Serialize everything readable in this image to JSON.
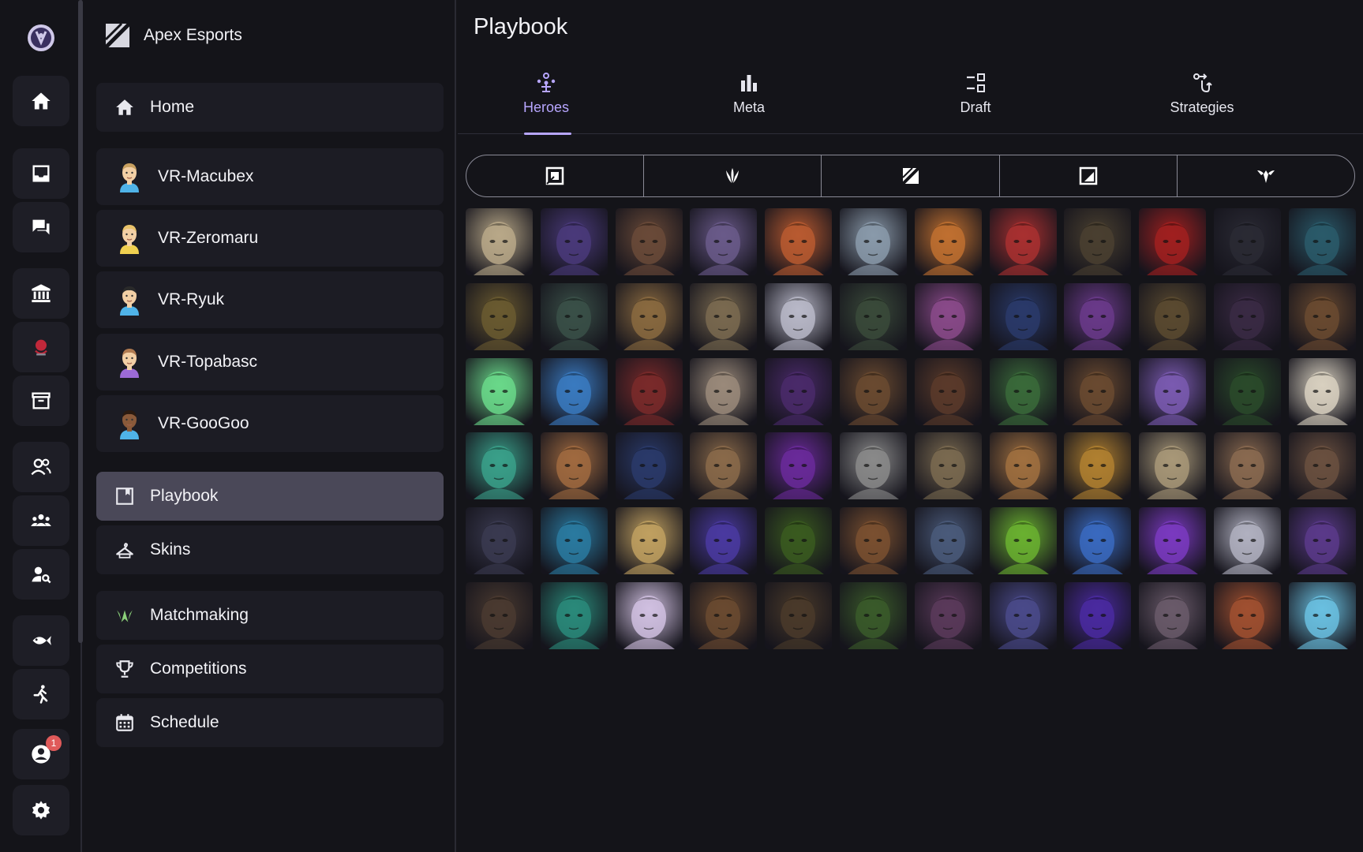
{
  "org": {
    "name": "Apex Esports"
  },
  "rail": {
    "items": [
      "logo-icon",
      "home-icon",
      "inbox-icon",
      "chat-icon",
      "bank-icon",
      "team-logo-icon",
      "archive-icon",
      "people-icon",
      "groups-icon",
      "person-search-icon",
      "fish-icon",
      "running-icon",
      "account-icon",
      "settings-icon"
    ],
    "notification_count": "1"
  },
  "nav": {
    "home": "Home",
    "players": [
      {
        "name": "VR-Macubex",
        "skin": "#f2cfa5",
        "hair": "#c8a060",
        "shirt": "#4fb3e8"
      },
      {
        "name": "VR-Zeromaru",
        "skin": "#f2cfa5",
        "hair": "#e8c26a",
        "shirt": "#f0d050"
      },
      {
        "name": "VR-Ryuk",
        "skin": "#f2cfa5",
        "hair": "#2a2a2a",
        "shirt": "#4fb3e8"
      },
      {
        "name": "VR-Topabasc",
        "skin": "#f2cfa5",
        "hair": "#b07a50",
        "shirt": "#9c6ad6"
      },
      {
        "name": "VR-GooGoo",
        "skin": "#8a5a3a",
        "hair": "#2a1a10",
        "shirt": "#4fb3e8"
      }
    ],
    "playbook": "Playbook",
    "skins": "Skins",
    "matchmaking": "Matchmaking",
    "competitions": "Competitions",
    "schedule": "Schedule"
  },
  "main": {
    "title": "Playbook",
    "tabs": [
      {
        "label": "Heroes",
        "icon": "heroes-icon",
        "active": true
      },
      {
        "label": "Meta",
        "icon": "bar-chart-icon",
        "active": false
      },
      {
        "label": "Draft",
        "icon": "draft-icon",
        "active": false
      },
      {
        "label": "Strategies",
        "icon": "strategies-icon",
        "active": false
      }
    ],
    "role_filters": [
      "role-tank-icon",
      "role-flame-icon",
      "role-slash-icon",
      "role-support-icon",
      "role-wing-icon"
    ]
  },
  "heroes": [
    [
      "#b8a888",
      "#4a3a7a",
      "#6a4a38",
      "#6a5a8a",
      "#b85a30",
      "#8a9aaa",
      "#c07030",
      "#a83030",
      "#4a4030",
      "#a02020",
      "#2a2a34",
      "#2a5a6a"
    ],
    [
      "#6a5a30",
      "#3a5048",
      "#8a6a40",
      "#7a6a50",
      "#b8b8c8",
      "#3a4a3a",
      "#8a4a8a",
      "#2a3a6a",
      "#6a3a8a",
      "#5a4a30",
      "#3a2a44",
      "#6a4a30"
    ],
    [
      "#6ad88a",
      "#3a7ac0",
      "#7a2a2a",
      "#9a8a7a",
      "#4a2a6a",
      "#6a4a30",
      "#5a3a2a",
      "#3a6a3a",
      "#6a4a30",
      "#7a5ab0",
      "#2a4a2a",
      "#d8d0c0"
    ],
    [
      "#3aa08a",
      "#a06a40",
      "#2a3a6a",
      "#8a6a4a",
      "#6a2a9a",
      "#8a8a8a",
      "#7a6a50",
      "#a07040",
      "#b08030",
      "#a89878",
      "#8a6a50",
      "#6a5040"
    ],
    [
      "#3a3a50",
      "#2a7aa0",
      "#c0a060",
      "#4a3aa0",
      "#3a5a20",
      "#7a5030",
      "#4a5a7a",
      "#6ab030",
      "#3a6ac0",
      "#7a3ac0",
      "#b0b0c0",
      "#5a3a8a"
    ],
    [
      "#4a3a30",
      "#2a8a7a",
      "#d0c0e0",
      "#6a4a30",
      "#4a3a2a",
      "#3a5a2a",
      "#5a3a5a",
      "#4a4a8a",
      "#4a2aa0",
      "#6a5a6a",
      "#a05030",
      "#6ac0e0"
    ]
  ]
}
